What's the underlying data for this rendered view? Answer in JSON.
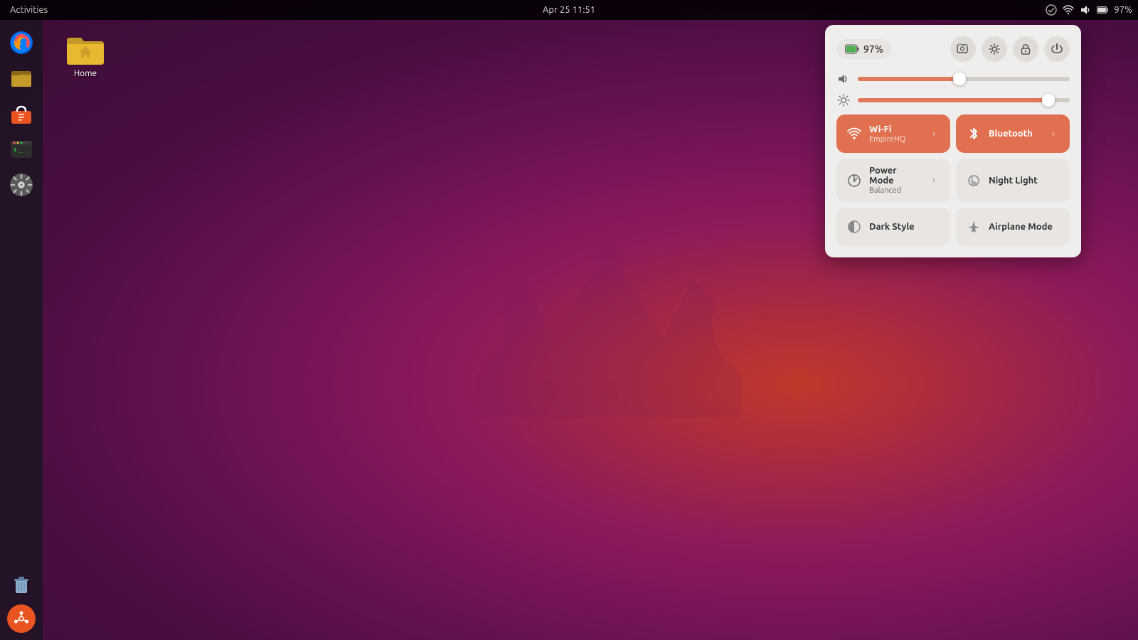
{
  "topbar": {
    "datetime": "Apr 25  11:51",
    "battery_pct": "97%",
    "activities_label": "Activities"
  },
  "desktop": {
    "home_label": "Home"
  },
  "quick_settings": {
    "battery_label": "97%",
    "volume_pct": 48,
    "brightness_pct": 95,
    "wifi": {
      "label": "Wi-Fi",
      "sublabel": "EmpireHQ",
      "active": true
    },
    "bluetooth": {
      "label": "Bluetooth",
      "active": true
    },
    "power_mode": {
      "label": "Power Mode",
      "sublabel": "Balanced",
      "active": false
    },
    "night_light": {
      "label": "Night Light",
      "active": false
    },
    "dark_style": {
      "label": "Dark Style",
      "active": false
    },
    "airplane_mode": {
      "label": "Airplane Mode",
      "active": false
    }
  },
  "dock": {
    "items": [
      {
        "name": "firefox",
        "label": "Firefox"
      },
      {
        "name": "files",
        "label": "Files"
      },
      {
        "name": "app-center",
        "label": "App Center"
      },
      {
        "name": "terminal",
        "label": "Terminal"
      },
      {
        "name": "settings",
        "label": "Settings"
      },
      {
        "name": "trash",
        "label": "Trash"
      },
      {
        "name": "ubuntu",
        "label": "Ubuntu"
      }
    ]
  }
}
